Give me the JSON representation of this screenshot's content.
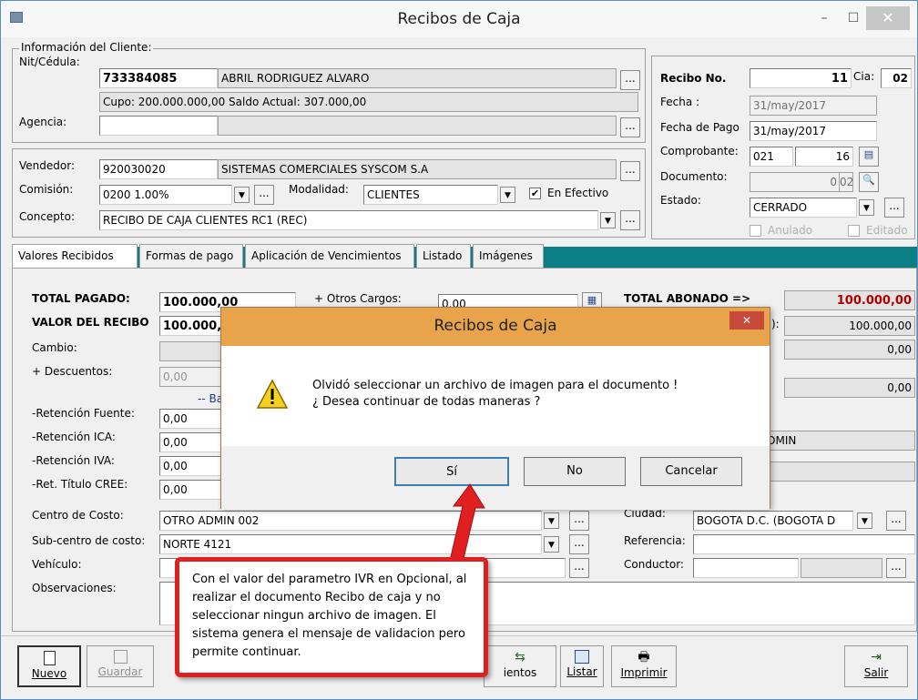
{
  "window": {
    "title": "Recibos de Caja",
    "minimize": "–",
    "maximize": "☐",
    "close": "✕"
  },
  "client": {
    "group_label": "Información del Cliente:",
    "nit_label": "Nit/Cédula:",
    "nit_value": "733384085",
    "name_value": "ABRIL RODRIGUEZ ALVARO",
    "cupo_text": "Cupo: 200.000.000,00  Saldo Actual: 307.000,00",
    "agencia_label": "Agencia:",
    "agencia_value": "",
    "dots": "..."
  },
  "recibo": {
    "recibo_label": "Recibo No.",
    "recibo_value": "11",
    "cia_label": "Cia:",
    "cia_value": "02",
    "fecha_label": "Fecha :",
    "fecha_value": "31/may/2017",
    "fecha_pago_label": "Fecha de Pago",
    "fecha_pago_value": "31/may/2017",
    "comprobante_label": "Comprobante:",
    "comprobante_code": "021",
    "comprobante_num": "16",
    "documento_label": "Documento:",
    "documento_num": "0",
    "documento_cia": "02",
    "estado_label": "Estado:",
    "estado_value": "CERRADO",
    "anulado_label": "Anulado",
    "editado_label": "Editado"
  },
  "vendedor": {
    "vendedor_label": "Vendedor:",
    "vendedor_code": "920030020",
    "vendedor_name": "SISTEMAS COMERCIALES SYSCOM S.A",
    "comision_label": "Comisión:",
    "comision_value": "0200  1.00%",
    "modalidad_label": "Modalidad:",
    "modalidad_value": "CLIENTES",
    "en_efectivo_label": "En Efectivo",
    "concepto_label": "Concepto:",
    "concepto_value": "RECIBO DE CAJA CLIENTES RC1  (REC)"
  },
  "tabs": [
    "Valores Recibidos",
    "Formas de pago",
    "Aplicación de Vencimientos",
    "Listado",
    "Imágenes"
  ],
  "valores": {
    "total_pagado_label": "TOTAL PAGADO:",
    "total_pagado_value": "100.000,00",
    "valor_recibo_label": "VALOR DEL RECIBO",
    "valor_recibo_value": "100.000,0",
    "cambio_label": "Cambio:",
    "descuentos_label": "+ Descuentos:",
    "descuentos_value": "0,00",
    "bas_label": "-- Bas",
    "ret_fuente_label": "-Retención Fuente:",
    "ret_fuente_value": "0,00",
    "ret_ica_label": "-Retención ICA:",
    "ret_ica_value": "0,00",
    "ret_iva_label": "-Retención IVA:",
    "ret_iva_value": "0,00",
    "ret_cree_label": "-Ret. Título CREE:",
    "ret_cree_value": "0,00",
    "otros_cargos_label": "+ Otros Cargos:",
    "otros_cargos_value": "0,00",
    "total_abonado_label": "TOTAL ABONADO =>",
    "total_abonado_value": "100.000,00",
    "right_val_1_suffix": "):",
    "right_val_1": "100.000,00",
    "right_val_2": "0,00",
    "right_val_3": "0,00",
    "admin_text": "ADOR ADMIN",
    "centro_costo_label": "Centro de Costo:",
    "centro_costo_value": "OTRO ADMIN 002",
    "subcentro_label": "Sub-centro de costo:",
    "subcentro_value": "NORTE 4121",
    "vehiculo_label": "Vehículo:",
    "observaciones_label": "Observaciones:",
    "ciudad_label": "Ciudad:",
    "ciudad_value": "BOGOTA D.C.  (BOGOTA D",
    "referencia_label": "Referencia:",
    "conductor_label": "Conductor:"
  },
  "toolbar": {
    "nuevo": "Nuevo",
    "guardar": "Guardar",
    "vencimientos": "ientos",
    "listar": "Listar",
    "imprimir": "Imprimir",
    "salir": "Salir"
  },
  "dialog": {
    "title": "Recibos de Caja",
    "line1": "Olvidó seleccionar un archivo de imagen para el documento !",
    "line2": "¿ Desea continuar de todas maneras ?",
    "yes": "Sí",
    "no": "No",
    "cancel": "Cancelar",
    "close": "✕"
  },
  "callout": {
    "text": "Con el valor del parametro IVR en Opcional, al realizar el documento Recibo de caja y no seleccionar ningun archivo de imagen. El sistema genera el mensaje de validacion pero permite continuar."
  },
  "colors": {
    "tab_strip": "#0c7e85",
    "dialog_title": "#e8a44a",
    "callout_border": "#e02020",
    "total_red": "#b00000"
  }
}
